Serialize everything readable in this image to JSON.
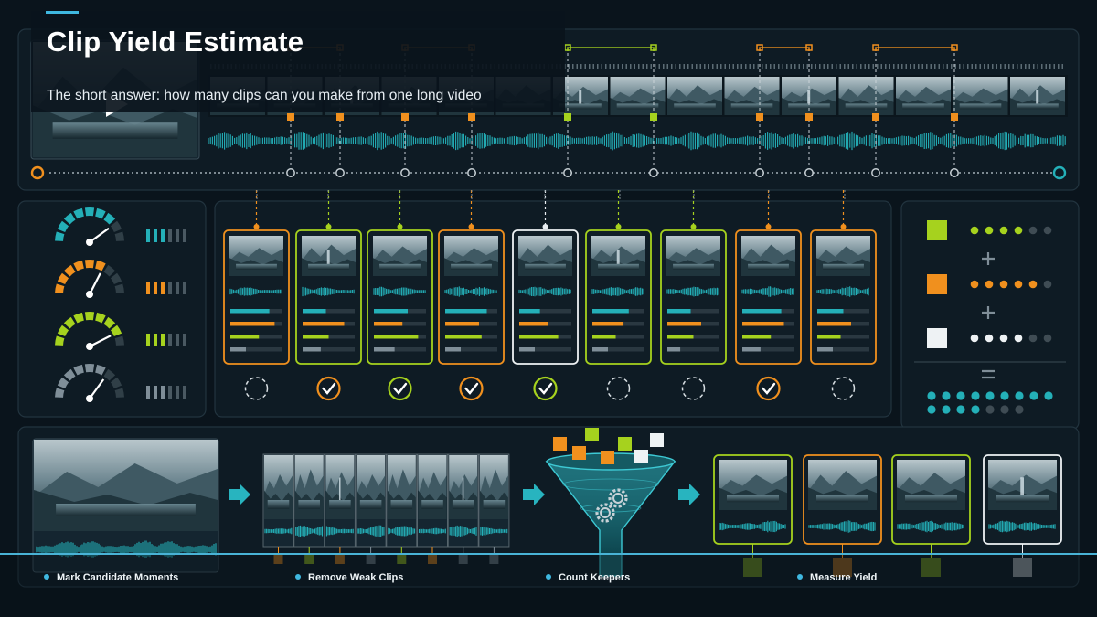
{
  "header": {
    "title": "Clip Yield Estimate",
    "subtitle": "The short answer: how many clips can you make from one long video"
  },
  "steps": [
    {
      "label": "Mark Candidate Moments"
    },
    {
      "label": "Remove Weak Clips"
    },
    {
      "label": "Count Keepers"
    },
    {
      "label": "Measure Yield"
    }
  ],
  "colors": {
    "teal": "#24b0b8",
    "orange": "#f0901e",
    "lime": "#a6d21e",
    "white": "#eef2f4",
    "gray": "#7f8e98",
    "accent_blue": "#3fb8e0"
  },
  "icons": {
    "play": "play-icon",
    "gauge": "gauge-icon",
    "check": "check-circle-icon",
    "empty": "empty-circle-icon",
    "arrow": "arrow-right-icon",
    "funnel": "funnel-icon",
    "gears": "gears-icon",
    "cube": "cube-icon"
  },
  "candidates": [
    {
      "color": "orange",
      "kept": true
    },
    {
      "color": "orange",
      "kept": false
    },
    {
      "color": "lime",
      "kept": true
    },
    {
      "color": "lime",
      "kept": true
    },
    {
      "color": "orange",
      "kept": true
    },
    {
      "color": "orange",
      "kept": true
    },
    {
      "color": "lime",
      "kept": false
    },
    {
      "color": "lime",
      "kept": false
    },
    {
      "color": "orange",
      "kept": true
    },
    {
      "color": "orange",
      "kept": false
    }
  ],
  "clip_cards": [
    {
      "color": "orange",
      "bars": [
        0.75,
        0.85,
        0.55,
        0.3
      ],
      "status": "empty"
    },
    {
      "color": "lime",
      "bars": [
        0.45,
        0.8,
        0.5,
        0.35
      ],
      "status": "check-orange"
    },
    {
      "color": "lime",
      "bars": [
        0.65,
        0.55,
        0.85,
        0.4
      ],
      "status": "check-lime"
    },
    {
      "color": "orange",
      "bars": [
        0.8,
        0.65,
        0.7,
        0.3
      ],
      "status": "check-orange"
    },
    {
      "color": "white",
      "bars": [
        0.4,
        0.55,
        0.75,
        0.3
      ],
      "status": "check-lime"
    },
    {
      "color": "lime",
      "bars": [
        0.7,
        0.6,
        0.45,
        0.3
      ],
      "status": "empty"
    },
    {
      "color": "lime",
      "bars": [
        0.45,
        0.65,
        0.5,
        0.25
      ],
      "status": "empty"
    },
    {
      "color": "orange",
      "bars": [
        0.75,
        0.8,
        0.55,
        0.35
      ],
      "status": "check-orange"
    },
    {
      "color": "orange",
      "bars": [
        0.5,
        0.65,
        0.45,
        0.3
      ],
      "status": "empty"
    }
  ],
  "gauges": [
    {
      "color": "teal",
      "level": 0.8
    },
    {
      "color": "orange",
      "level": 0.65
    },
    {
      "color": "lime",
      "level": 0.85
    },
    {
      "color": "gray",
      "level": 0.7
    }
  ],
  "tally": [
    {
      "color": "lime",
      "filled": 4,
      "total": 6,
      "operator": "+"
    },
    {
      "color": "orange",
      "filled": 5,
      "total": 6,
      "operator": "+"
    },
    {
      "color": "white",
      "filled": 4,
      "total": 6,
      "operator": "="
    }
  ],
  "tally_total": {
    "color": "teal",
    "filled": 13,
    "total": 16
  },
  "strip_frames": 8,
  "final_clips": [
    {
      "color": "lime"
    },
    {
      "color": "orange"
    },
    {
      "color": "lime"
    },
    {
      "color": "white"
    }
  ]
}
